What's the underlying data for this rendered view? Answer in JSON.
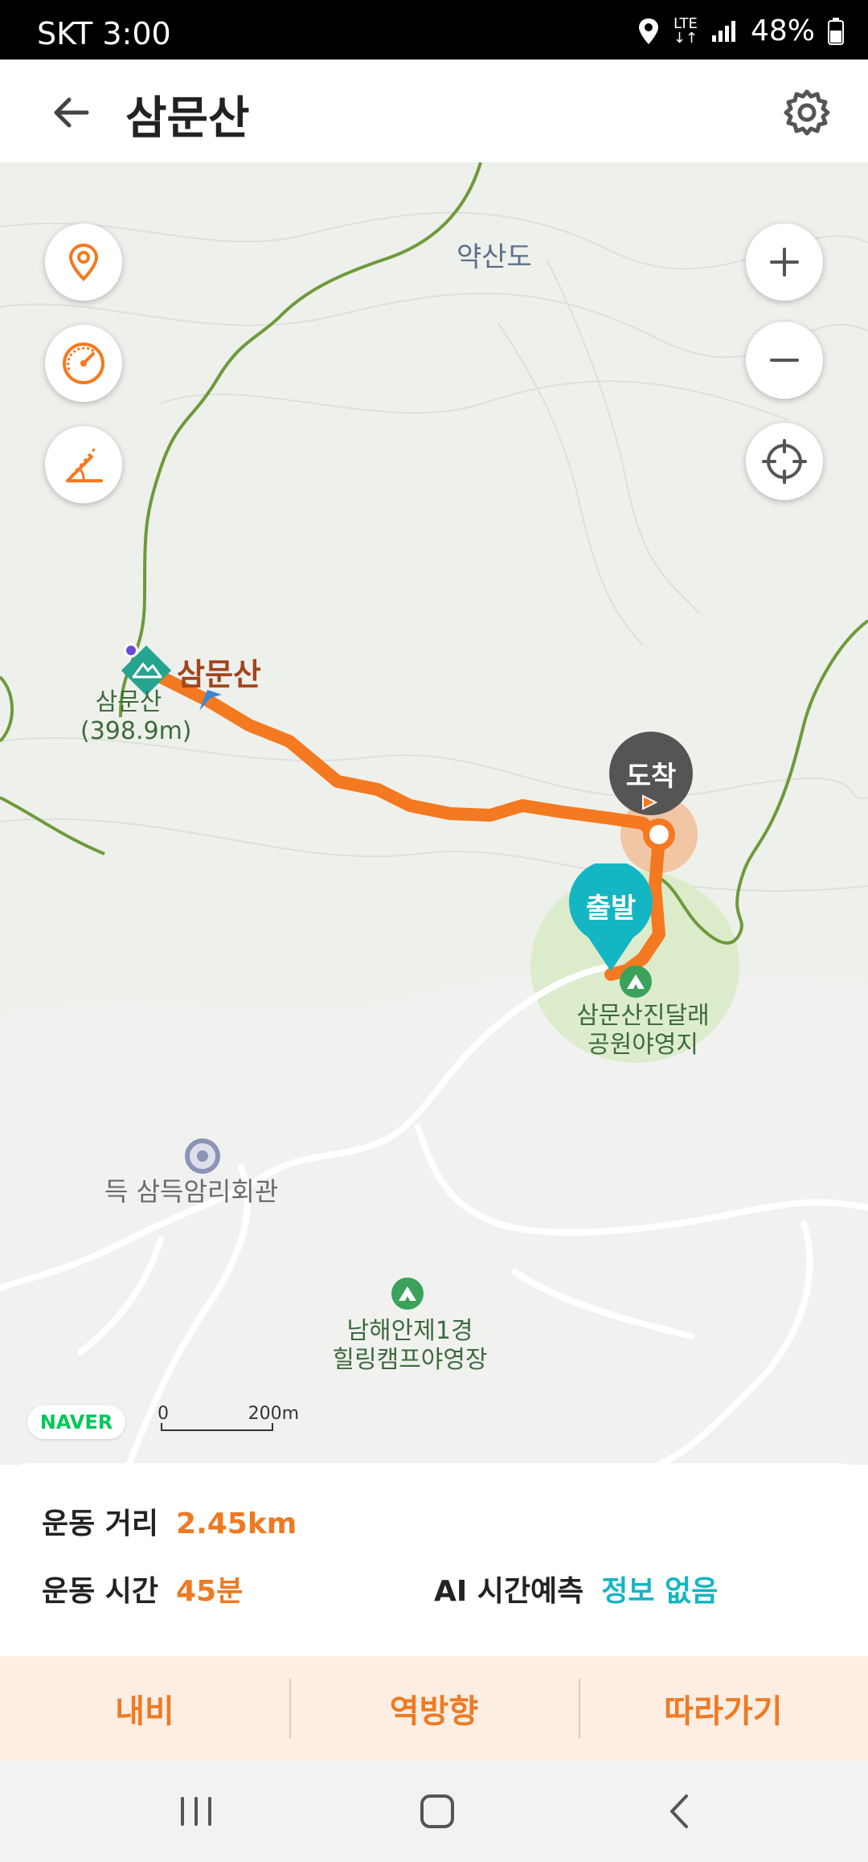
{
  "status_bar": {
    "carrier_time": "SKT 3:00",
    "network": "LTE",
    "battery": "48%",
    "icons": [
      "location-icon",
      "lte-icon",
      "signal-icon",
      "battery-icon"
    ]
  },
  "header": {
    "title": "삼문산",
    "back_icon": "arrow-left-icon",
    "settings_icon": "gear-icon"
  },
  "map": {
    "controls_left": [
      "location-pin-icon",
      "speedometer-icon",
      "slope-icon"
    ],
    "controls_right": [
      "zoom-in-icon",
      "zoom-out-icon",
      "crosshair-icon"
    ],
    "labels": {
      "yaksando": "약산도",
      "peak_name": "삼문산",
      "peak_small_name": "삼문산",
      "peak_height": "(398.9m)",
      "campsite_line1": "삼문산진달래",
      "campsite_line2": "공원야영지",
      "hall": "득 삼득암리회관",
      "camp2_line1": "남해안제1경",
      "camp2_line2": "힐링캠프야영장"
    },
    "pins": {
      "arrival": "도착",
      "departure": "출발"
    },
    "brand": "NAVER",
    "scale_start": "0",
    "scale_end": "200m",
    "colors": {
      "route": "#f47920",
      "trail": "#6e9a3a",
      "departure": "#14b6c4",
      "arrival": "#555555"
    }
  },
  "stats": {
    "distance_label": "운동 거리",
    "distance_value": "2.45km",
    "time_label": "운동 시간",
    "time_value": "45분",
    "ai_label": "AI 시간예측",
    "ai_value": "정보 없음"
  },
  "actions": {
    "navigate": "내비",
    "reverse": "역방향",
    "follow": "따라가기"
  },
  "nav_bar": {
    "icons": [
      "recent-apps-icon",
      "home-icon",
      "back-icon"
    ]
  }
}
